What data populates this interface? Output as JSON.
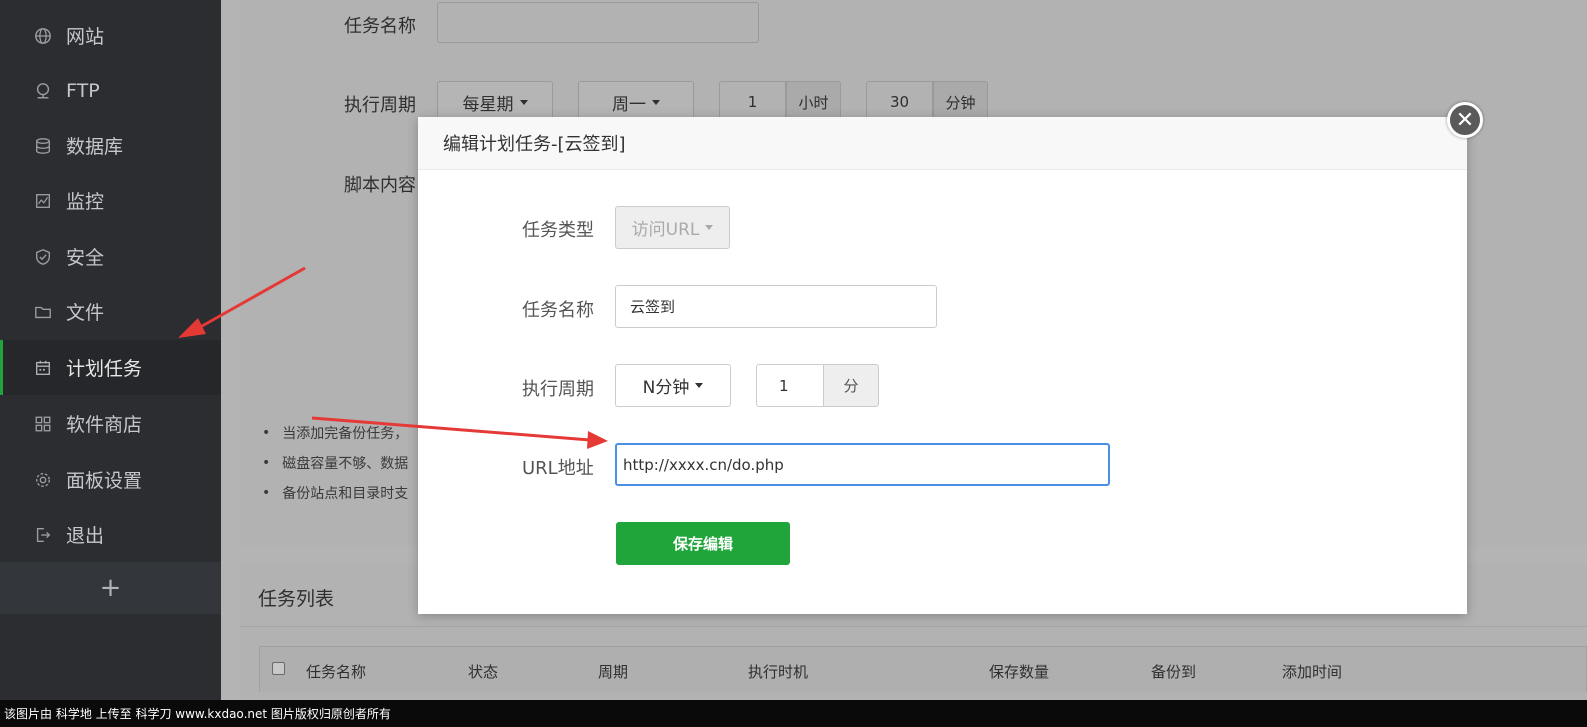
{
  "sidebar": {
    "items": [
      {
        "label": "网站",
        "icon": "globe-icon"
      },
      {
        "label": "FTP",
        "icon": "ftp-icon"
      },
      {
        "label": "数据库",
        "icon": "database-icon"
      },
      {
        "label": "监控",
        "icon": "monitor-icon"
      },
      {
        "label": "安全",
        "icon": "shield-icon"
      },
      {
        "label": "文件",
        "icon": "folder-icon"
      },
      {
        "label": "计划任务",
        "icon": "calendar-icon",
        "active": true
      },
      {
        "label": "软件商店",
        "icon": "grid-icon"
      },
      {
        "label": "面板设置",
        "icon": "gear-icon"
      },
      {
        "label": "退出",
        "icon": "logout-icon"
      }
    ],
    "add_label": "+"
  },
  "background_form": {
    "task_name_label": "任务名称",
    "cycle_label": "执行周期",
    "cycle_value": "每星期",
    "weekday_value": "周一",
    "hour_value": "1",
    "hour_unit": "小时",
    "minute_value": "30",
    "minute_unit": "分钟",
    "script_label": "脚本内容",
    "notes": [
      "当添加完备份任务，",
      "磁盘容量不够、数据",
      "备份站点和目录时支"
    ]
  },
  "task_list": {
    "title": "任务列表",
    "columns": [
      "任务名称",
      "状态",
      "周期",
      "执行时机",
      "保存数量",
      "备份到",
      "添加时间"
    ]
  },
  "modal": {
    "title": "编辑计划任务-[云签到]",
    "close_symbol": "✕",
    "task_type_label": "任务类型",
    "task_type_value": "访问URL",
    "task_name_label": "任务名称",
    "task_name_value": "云签到",
    "cycle_label": "执行周期",
    "cycle_value": "N分钟",
    "cycle_number": "1",
    "cycle_unit": "分",
    "url_label": "URL地址",
    "url_value": "http://xxxx.cn/do.php",
    "save_label": "保存编辑"
  },
  "footer": {
    "text": "该图片由 科学地 上传至 科学刀 www.kxdao.net 图片版权归原创者所有"
  },
  "colors": {
    "accent": "#20a53a",
    "sidebar_bg": "#2b2d31",
    "focus_border": "#4a90e2",
    "annotation_arrow": "#e53935"
  }
}
